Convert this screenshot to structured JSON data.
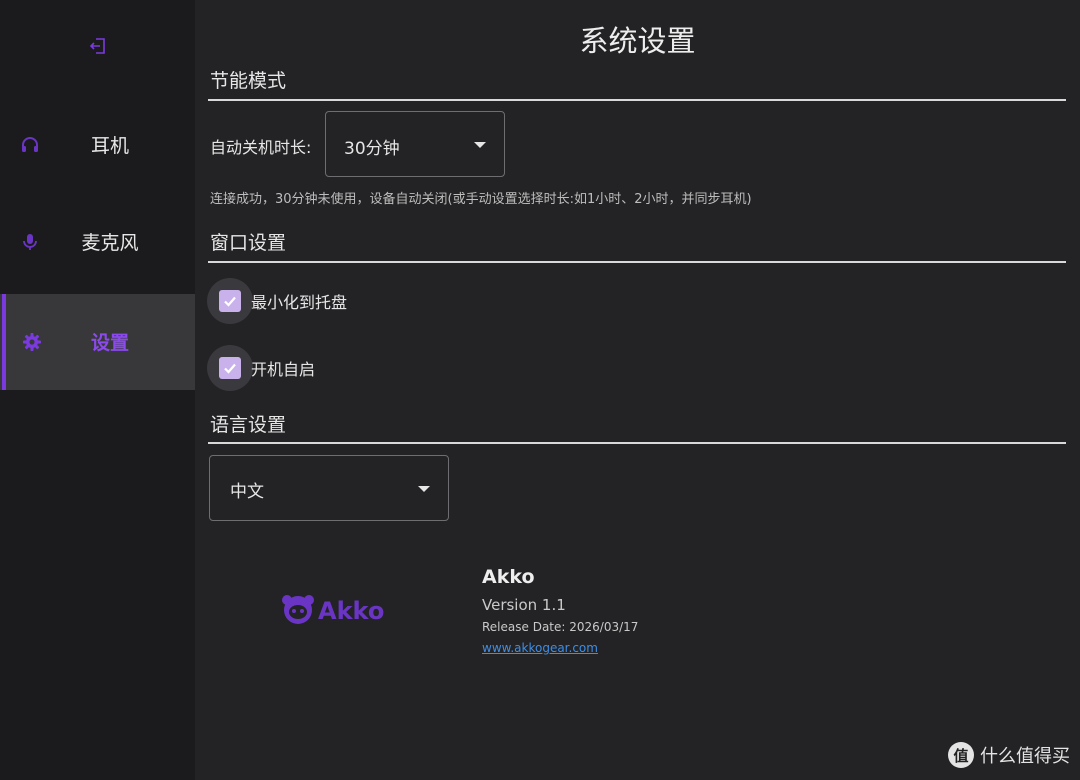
{
  "colors": {
    "accent": "#7b3ae0",
    "background": "#232325",
    "sidebar": "#1b1b1d",
    "active_item": "#38383b",
    "link": "#3e8ee6"
  },
  "sidebar": {
    "exit_icon": "logout-icon",
    "items": [
      {
        "icon": "headphones-icon",
        "label": "耳机",
        "active": false
      },
      {
        "icon": "microphone-icon",
        "label": "麦克风",
        "active": false
      },
      {
        "icon": "gear-icon",
        "label": "设置",
        "active": true
      }
    ]
  },
  "page": {
    "title": "系统设置"
  },
  "power_saving": {
    "title": "节能模式",
    "auto_off_label": "自动关机时长:",
    "auto_off_value": "30分钟",
    "hint": "连接成功，30分钟未使用，设备自动关闭(或手动设置选择时长:如1小时、2小时，并同步耳机)"
  },
  "window_settings": {
    "title": "窗口设置",
    "options": [
      {
        "label": "最小化到托盘",
        "checked": true
      },
      {
        "label": "开机自启",
        "checked": true
      }
    ]
  },
  "language": {
    "title": "语言设置",
    "value": "中文"
  },
  "about": {
    "logo_text": "Akko",
    "name": "Akko",
    "version": "Version 1.1",
    "release": "Release Date: 2026/03/17",
    "link": "www.akkogear.com"
  },
  "watermark": {
    "badge": "值",
    "text": "什么值得买"
  }
}
